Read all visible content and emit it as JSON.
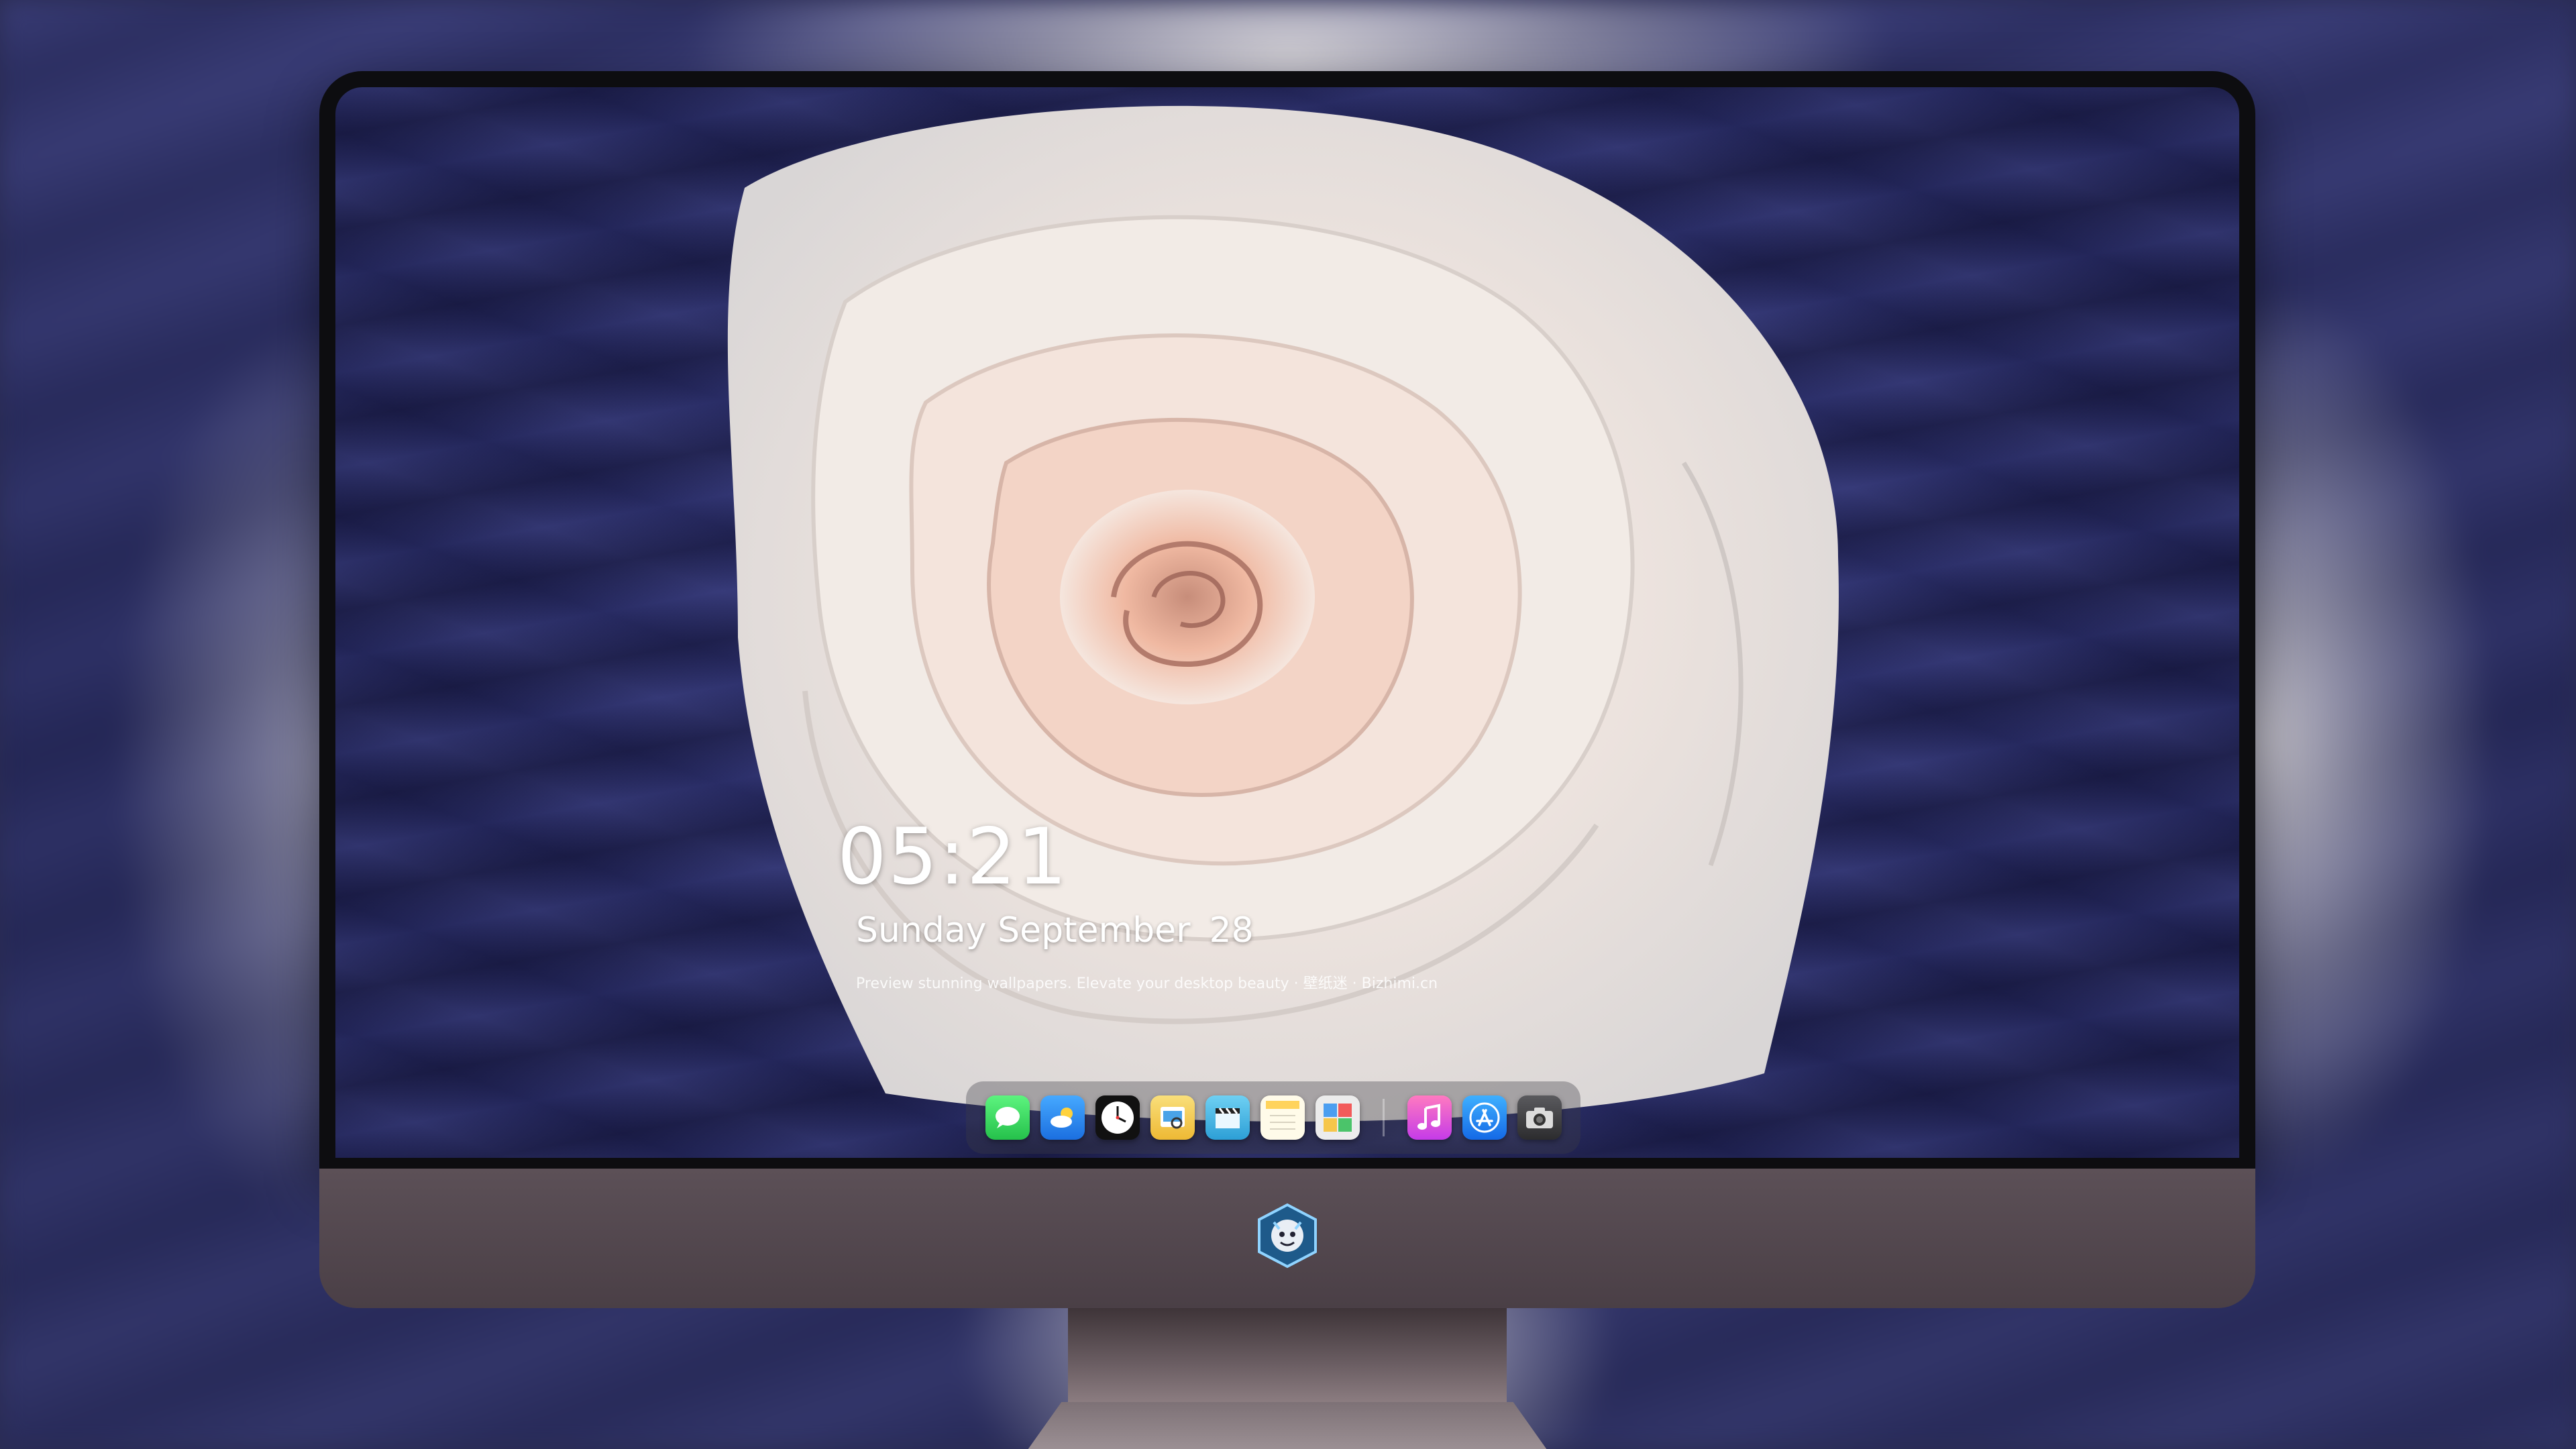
{
  "clock": {
    "time": "05:21",
    "date_label": "Sunday September",
    "day": "28",
    "tagline": "Preview stunning wallpapers. Elevate your desktop beauty · 壁纸迷 · Bizhimi.cn"
  },
  "dock": {
    "items": [
      {
        "name": "messages",
        "icon": "messages-icon",
        "color": "#2fd158"
      },
      {
        "name": "weather",
        "icon": "weather-icon",
        "color": "#2e8df3"
      },
      {
        "name": "clock",
        "icon": "clock-icon",
        "color": "#111111"
      },
      {
        "name": "preview",
        "icon": "preview-icon",
        "color": "#f6c94a"
      },
      {
        "name": "clips",
        "icon": "clapperboard-icon",
        "color": "#3bb6e6"
      },
      {
        "name": "notes",
        "icon": "notes-icon",
        "color": "#ffd35c"
      },
      {
        "name": "photo-booth",
        "icon": "photo-booth-icon",
        "color": "#e9e9e9"
      },
      {
        "name": "music",
        "icon": "music-icon",
        "color": "#f2599b"
      },
      {
        "name": "app-store",
        "icon": "app-store-icon",
        "color": "#1f8ef5"
      },
      {
        "name": "camera",
        "icon": "camera-icon",
        "color": "#3a3a3c"
      }
    ]
  },
  "colors": {
    "wallpaper_background": "#2c2f63",
    "rose": "#f3efea",
    "rose_center": "#f0b9a2",
    "monitor_chin": "#54484f",
    "bezel": "#0d0d10"
  }
}
